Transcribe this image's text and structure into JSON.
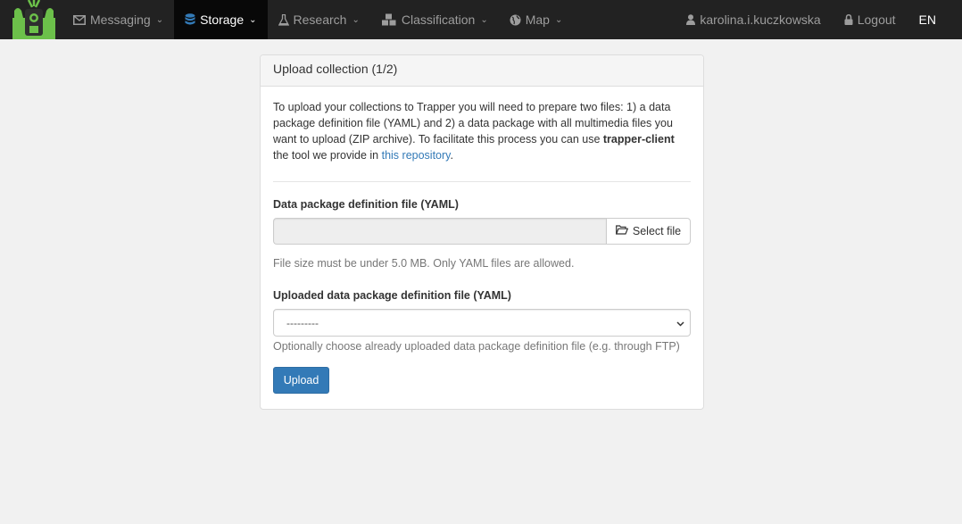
{
  "navbar": {
    "brand_alt": "Trapper",
    "items": [
      {
        "label": "Messaging",
        "icon": "envelope-icon"
      },
      {
        "label": "Storage",
        "icon": "database-icon",
        "active": true
      },
      {
        "label": "Research",
        "icon": "flask-icon"
      },
      {
        "label": "Classification",
        "icon": "cubes-icon"
      },
      {
        "label": "Map",
        "icon": "globe-icon"
      }
    ],
    "user": {
      "label": "karolina.i.kuczkowska",
      "icon": "user-icon"
    },
    "logout": {
      "label": "Logout",
      "icon": "lock-icon"
    },
    "language": "EN"
  },
  "panel": {
    "title": "Upload collection (1/2)",
    "intro": {
      "part1": "To upload your collections to Trapper you will need to prepare two files: 1) a data package definition file (YAML) and 2) a data package with all multimedia files you want to upload (ZIP archive). To facilitate this process you can use ",
      "bold": "trapper-client",
      "part2": " the tool we provide in ",
      "link": "this repository",
      "part3": "."
    },
    "file_field": {
      "label": "Data package definition file (YAML)",
      "value": "",
      "button_label": "Select file",
      "help": "File size must be under 5.0 MB. Only YAML files are allowed."
    },
    "uploaded_field": {
      "label": "Uploaded data package definition file (YAML)",
      "selected": "---------",
      "help": "Optionally choose already uploaded data package definition file (e.g. through FTP)"
    },
    "submit_label": "Upload"
  },
  "colors": {
    "navbar_bg": "#222222",
    "navbar_active_bg": "#080808",
    "brand_green": "#6cc04a",
    "primary": "#337ab7",
    "page_bg": "#f1f1f1"
  }
}
